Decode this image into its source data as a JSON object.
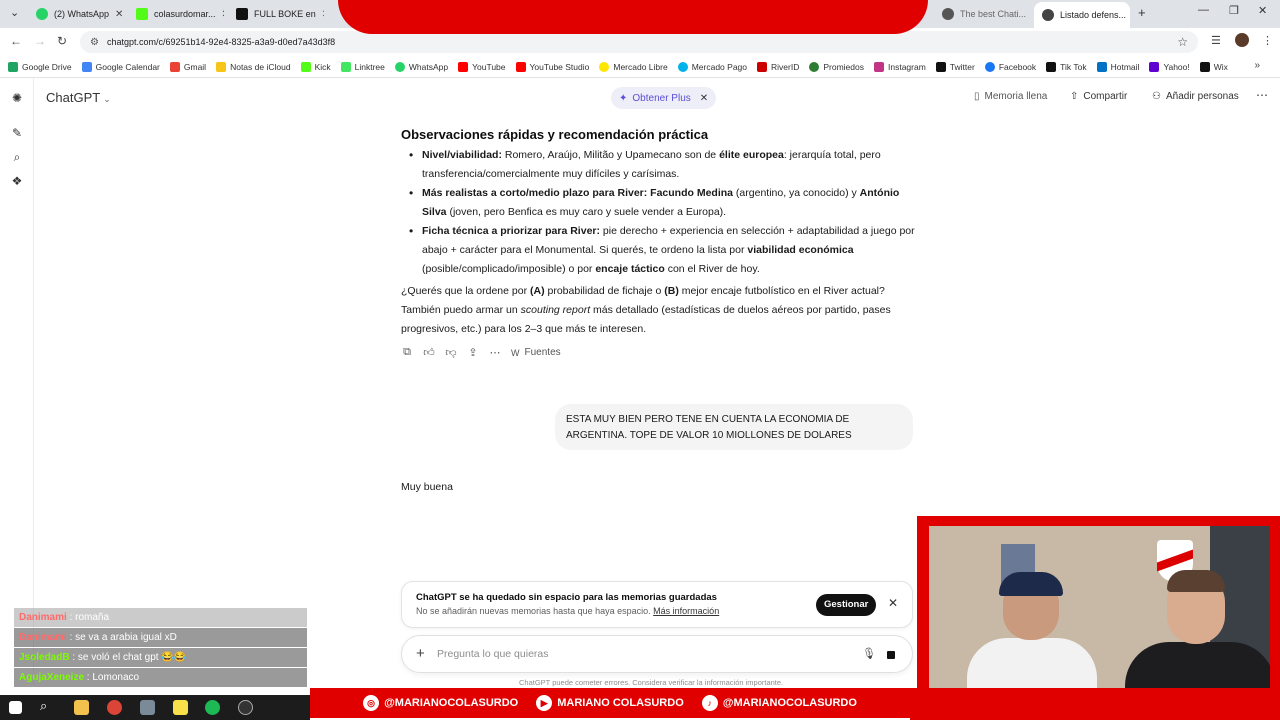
{
  "browser": {
    "tabs": [
      {
        "label": "(2) WhatsApp",
        "color": "#25d366"
      },
      {
        "label": "colasurdomar...",
        "color": "#53fc18"
      },
      {
        "label": "FULL BOKE en",
        "color": "#111111"
      },
      {
        "label": "",
        "color": "#333333"
      },
      {
        "label": "The best Chati...",
        "color": "#555555"
      },
      {
        "label": "Listado defens...",
        "color": "#444444"
      }
    ],
    "url": "chatgpt.com/c/69251b14-92e4-8325-a3a9-d0ed7a43d3f8",
    "bookmarks": [
      {
        "label": "Google Drive",
        "color": "#1fa463"
      },
      {
        "label": "Google Calendar",
        "color": "#4285f4"
      },
      {
        "label": "Gmail",
        "color": "#ea4335"
      },
      {
        "label": "Notas de iCloud",
        "color": "#f5c518"
      },
      {
        "label": "Kick",
        "color": "#53fc18"
      },
      {
        "label": "Linktree",
        "color": "#43e660"
      },
      {
        "label": "WhatsApp",
        "color": "#25d366"
      },
      {
        "label": "YouTube",
        "color": "#ff0000"
      },
      {
        "label": "YouTube Studio",
        "color": "#ff0000"
      },
      {
        "label": "Mercado Libre",
        "color": "#ffe600"
      },
      {
        "label": "Mercado Pago",
        "color": "#00b1ea"
      },
      {
        "label": "RiverID",
        "color": "#cc0000"
      },
      {
        "label": "Promiedos",
        "color": "#2e7d32"
      },
      {
        "label": "Instagram",
        "color": "#c13584"
      },
      {
        "label": "Twitter",
        "color": "#111111"
      },
      {
        "label": "Facebook",
        "color": "#1877f2"
      },
      {
        "label": "Tik Tok",
        "color": "#111111"
      },
      {
        "label": "Hotmail",
        "color": "#0072c6"
      },
      {
        "label": "Yahoo!",
        "color": "#6001d2"
      },
      {
        "label": "Wix",
        "color": "#111111"
      }
    ]
  },
  "app": {
    "brand": "ChatGPT",
    "plus_pill": "Obtener Plus",
    "memory": "Memoria llena",
    "share": "Compartir",
    "add_people": "Añadir personas"
  },
  "message": {
    "heading": "Observaciones rápidas y recomendación práctica",
    "bullets": [
      {
        "b1": "Nivel/viabilidad:",
        "t1": " Romero, Araújo, Militão y Upamecano son de ",
        "b2": "élite europea",
        "t2": ": jerarquía total, pero transferencia/comercialmente muy difíciles y carísimas."
      },
      {
        "b1": "Más realistas a corto/medio plazo para River: Facundo Medina",
        "t1": " (argentino, ya conocido) y ",
        "b2": "António Silva",
        "t2": " (joven, pero Benfica es muy caro y suele vender a Europa)."
      },
      {
        "b1": "Ficha técnica a priorizar para River:",
        "t1": " pie derecho + experiencia en selección + adaptabilidad a juego por abajo + carácter para el Monumental. Si querés, te ordeno la lista por ",
        "b2": "viabilidad económica",
        "t2": " (posible/complicado/imposible) o por ",
        "b3": "encaje táctico",
        "t3": " con el River de hoy."
      }
    ],
    "question": {
      "p1": "¿Querés que la ordene por ",
      "b1": "(A)",
      "p2": " probabilidad de fichaje o ",
      "b2": "(B)",
      "p3": " mejor encaje futbolístico en el River actual? También puedo armar un ",
      "i1": "scouting report",
      "p4": " más detallado (estadísticas de duelos aéreos por partido, pases progresivos, etc.) para los 2–3 que más te interesen."
    },
    "sources": "Fuentes"
  },
  "user_message": "ESTA MUY BIEN PERO TENE EN CUENTA LA ECONOMIA DE ARGENTINA. TOPE DE VALOR 10 MIOLLONES DE DOLARES",
  "assistant_reply": "Muy buena",
  "memory_card": {
    "title": "ChatGPT se ha quedado sin espacio para las memorias guardadas",
    "subtitle": "No se añadirán nuevas memorias hasta que haya espacio.",
    "link": "Más información",
    "button": "Gestionar"
  },
  "composer": {
    "placeholder": "Pregunta lo que quieras",
    "disclaimer": "ChatGPT puede cometer errores. Considera verificar la información importante."
  },
  "stream_chat": [
    {
      "user": "Danimami",
      "text": "romaña",
      "color": "#ff6a6a"
    },
    {
      "user": "Danimami",
      "text": "se va a arabia igual xD",
      "color": "#ff6a6a"
    },
    {
      "user": "JsoledadB",
      "text": "se voló el chat gpt 😂😂",
      "color": "#7CFC00"
    },
    {
      "user": "AgujaXeneize",
      "text": "Lomonaco",
      "color": "#7CFC00"
    }
  ],
  "social": [
    {
      "icon": "◎",
      "label": "@MARIANOCOLASURDO"
    },
    {
      "icon": "▶",
      "label": "MARIANO COLASURDO"
    },
    {
      "icon": "♪",
      "label": "@MARIANOCOLASURDO"
    }
  ]
}
